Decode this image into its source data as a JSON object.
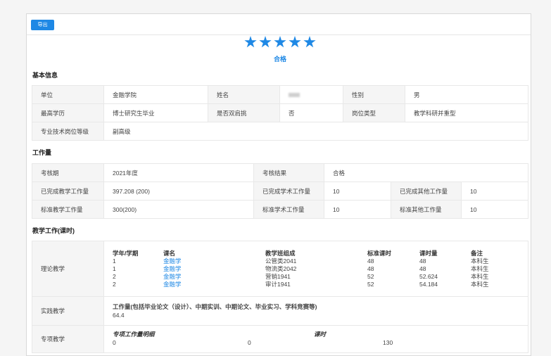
{
  "toolbar": {
    "export_label": "导出"
  },
  "rating": {
    "stars": 5,
    "max": 5,
    "label": "合格",
    "star_color": "#1e88e5"
  },
  "basic": {
    "title": "基本信息",
    "unit_label": "单位",
    "unit_value": "金融学院",
    "name_label": "姓名",
    "name_value": "",
    "gender_label": "性别",
    "gender_value": "男",
    "degree_label": "最高学历",
    "degree_value": "博士研究生毕业",
    "dual_label": "是否双肩挑",
    "dual_value": "否",
    "post_type_label": "岗位类型",
    "post_type_value": "教学科研并重型",
    "grade_label": "专业技术岗位等级",
    "grade_value": "副高级"
  },
  "workload": {
    "title": "工作量",
    "period_label": "考核期",
    "period_value": "2021年度",
    "result_label": "考核结果",
    "result_value": "合格",
    "done_teach_label": "已完成教学工作量",
    "done_teach_value": "397.208 (200)",
    "done_acad_label": "已完成学术工作量",
    "done_acad_value": "10",
    "done_other_label": "已完成其他工作量",
    "done_other_value": "10",
    "std_teach_label": "标准教学工作量",
    "std_teach_value": "300(200)",
    "std_acad_label": "标准学术工作量",
    "std_acad_value": "10",
    "std_other_label": "标准其他工作量",
    "std_other_value": "10"
  },
  "teaching": {
    "title": "教学工作(课时)",
    "theory_label": "理论教学",
    "headers": {
      "term": "学年/学期",
      "course": "课名",
      "class": "教学班组成",
      "std_hours": "标准课时",
      "hours": "课时量",
      "note": "备注"
    },
    "rows": [
      {
        "term": "1",
        "course": "金融学",
        "class": "公管类2041",
        "std_hours": "48",
        "hours": "48",
        "note": "本科生"
      },
      {
        "term": "1",
        "course": "金融学",
        "class": "物流类2042",
        "std_hours": "48",
        "hours": "48",
        "note": "本科生"
      },
      {
        "term": "2",
        "course": "金融学",
        "class": "营销1941",
        "std_hours": "52",
        "hours": "52.624",
        "note": "本科生"
      },
      {
        "term": "2",
        "course": "金融学",
        "class": "审计1941",
        "std_hours": "52",
        "hours": "54.184",
        "note": "本科生"
      }
    ],
    "practice_label": "实践教学",
    "practice_header": "工作量(包括毕业论文（设计）、中期实训、中期论文、毕业实习、学科竞赛等)",
    "practice_value": "64.4",
    "special_label": "专项教学",
    "special_detail_header": "专项工作量明细",
    "special_hours_header": "课时",
    "special_detail_value": "0",
    "special_mid_value": "0",
    "special_hours_value": "130"
  }
}
